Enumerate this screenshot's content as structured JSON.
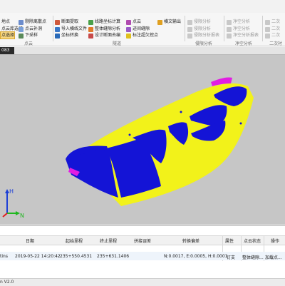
{
  "ribbon": {
    "row1": [
      {
        "label": "地点",
        "dim": false
      },
      {
        "label": "剔除离散点",
        "dim": false
      },
      {
        "label": "断面提取",
        "dim": false
      },
      {
        "label": "线路坐标计算",
        "dim": false
      },
      {
        "label": "点云",
        "dim": false
      },
      {
        "label": "横文输出",
        "dim": false
      },
      {
        "label": "侵限分析",
        "dim": true
      },
      {
        "label": "净空分析",
        "dim": true
      },
      {
        "label": "二次",
        "dim": true
      }
    ],
    "row2": [
      {
        "label": "点云库选择",
        "dim": false
      },
      {
        "label": "点云补洞",
        "dim": false
      },
      {
        "label": "导入横线文件",
        "dim": false
      },
      {
        "label": "整体缝隙分析",
        "dim": false
      },
      {
        "label": "迹间缝隙",
        "dim": false
      },
      {
        "label": "侵限分析",
        "dim": true
      },
      {
        "label": "净空分析",
        "dim": true
      },
      {
        "label": "二次",
        "dim": true
      }
    ],
    "row3": [
      {
        "label": "点选择",
        "dim": false
      },
      {
        "label": "下采样",
        "dim": false
      },
      {
        "label": "坐标转换",
        "dim": false
      },
      {
        "label": "设计断面去编",
        "dim": false
      },
      {
        "label": "标注超欠挖点",
        "dim": false
      },
      {
        "label": "侵限分析报表",
        "dim": true
      },
      {
        "label": "净空分析报表",
        "dim": true
      },
      {
        "label": "二次",
        "dim": true
      }
    ],
    "groups": [
      "点云",
      "隧道",
      "侵限分析",
      "净空分析",
      "二次衬"
    ]
  },
  "tab": {
    "label": "083"
  },
  "axes": {
    "h": "H",
    "n": "N"
  },
  "table": {
    "headers": [
      "日期",
      "起始里程",
      "终止里程",
      "拼接误差",
      "转换偏差",
      "属性",
      "点云状态",
      "操作"
    ],
    "rows": [
      [
        "tins",
        "2019-05-22 14:20:42",
        "235+550.4531",
        "235+631.1406",
        "",
        "N:0.0017, E:0.0005, H:0.0001",
        "钉支",
        "整体缝隙...",
        "加载点..."
      ]
    ]
  },
  "status": {
    "text": "n V2.0"
  },
  "colors": {
    "yellow": "#f2f21a",
    "blue": "#1414d6",
    "magenta": "#e21ee2",
    "viewport": "#c6c6c6"
  }
}
